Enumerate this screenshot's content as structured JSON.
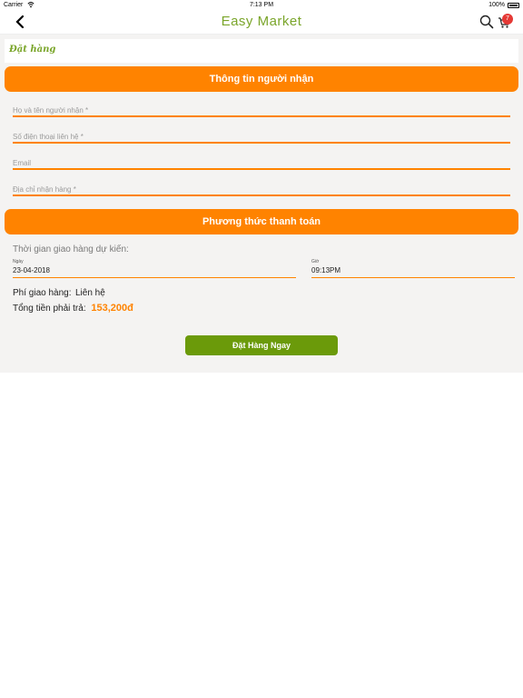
{
  "status_bar": {
    "carrier": "Carrier",
    "time": "7:13 PM",
    "battery": "100%"
  },
  "nav": {
    "title": "Easy Market",
    "cart_count": "7"
  },
  "breadcrumb": "Đặt hàng",
  "receiver_section": {
    "title": "Thông tin người nhận",
    "fields": {
      "name_placeholder": "Họ và tên người nhận *",
      "phone_placeholder": "Số điện thoại liên hệ *",
      "email_placeholder": "Email",
      "address_placeholder": "Địa chỉ nhận hàng *"
    }
  },
  "payment_section": {
    "title": "Phương thức thanh toán",
    "delivery_time_label": "Thời gian giao hàng dự kiến:",
    "date_label": "Ngày",
    "date_value": "23-04-2018",
    "hour_label": "Giờ",
    "hour_value": "09:13PM",
    "shipping_fee_label": "Phí giao hàng:",
    "shipping_fee_value": "Liên hệ",
    "total_label": "Tổng tiền phải trả:",
    "total_value": "153,200đ"
  },
  "order_button": "Đặt Hàng Ngay",
  "colors": {
    "accent": "#ff8300",
    "brand_green": "#7aa52a",
    "button_green": "#6b9a0a",
    "background": "#f4f3f2"
  },
  "icons": [
    "back-icon",
    "search-icon",
    "cart-icon",
    "wifi-icon",
    "battery-icon"
  ]
}
